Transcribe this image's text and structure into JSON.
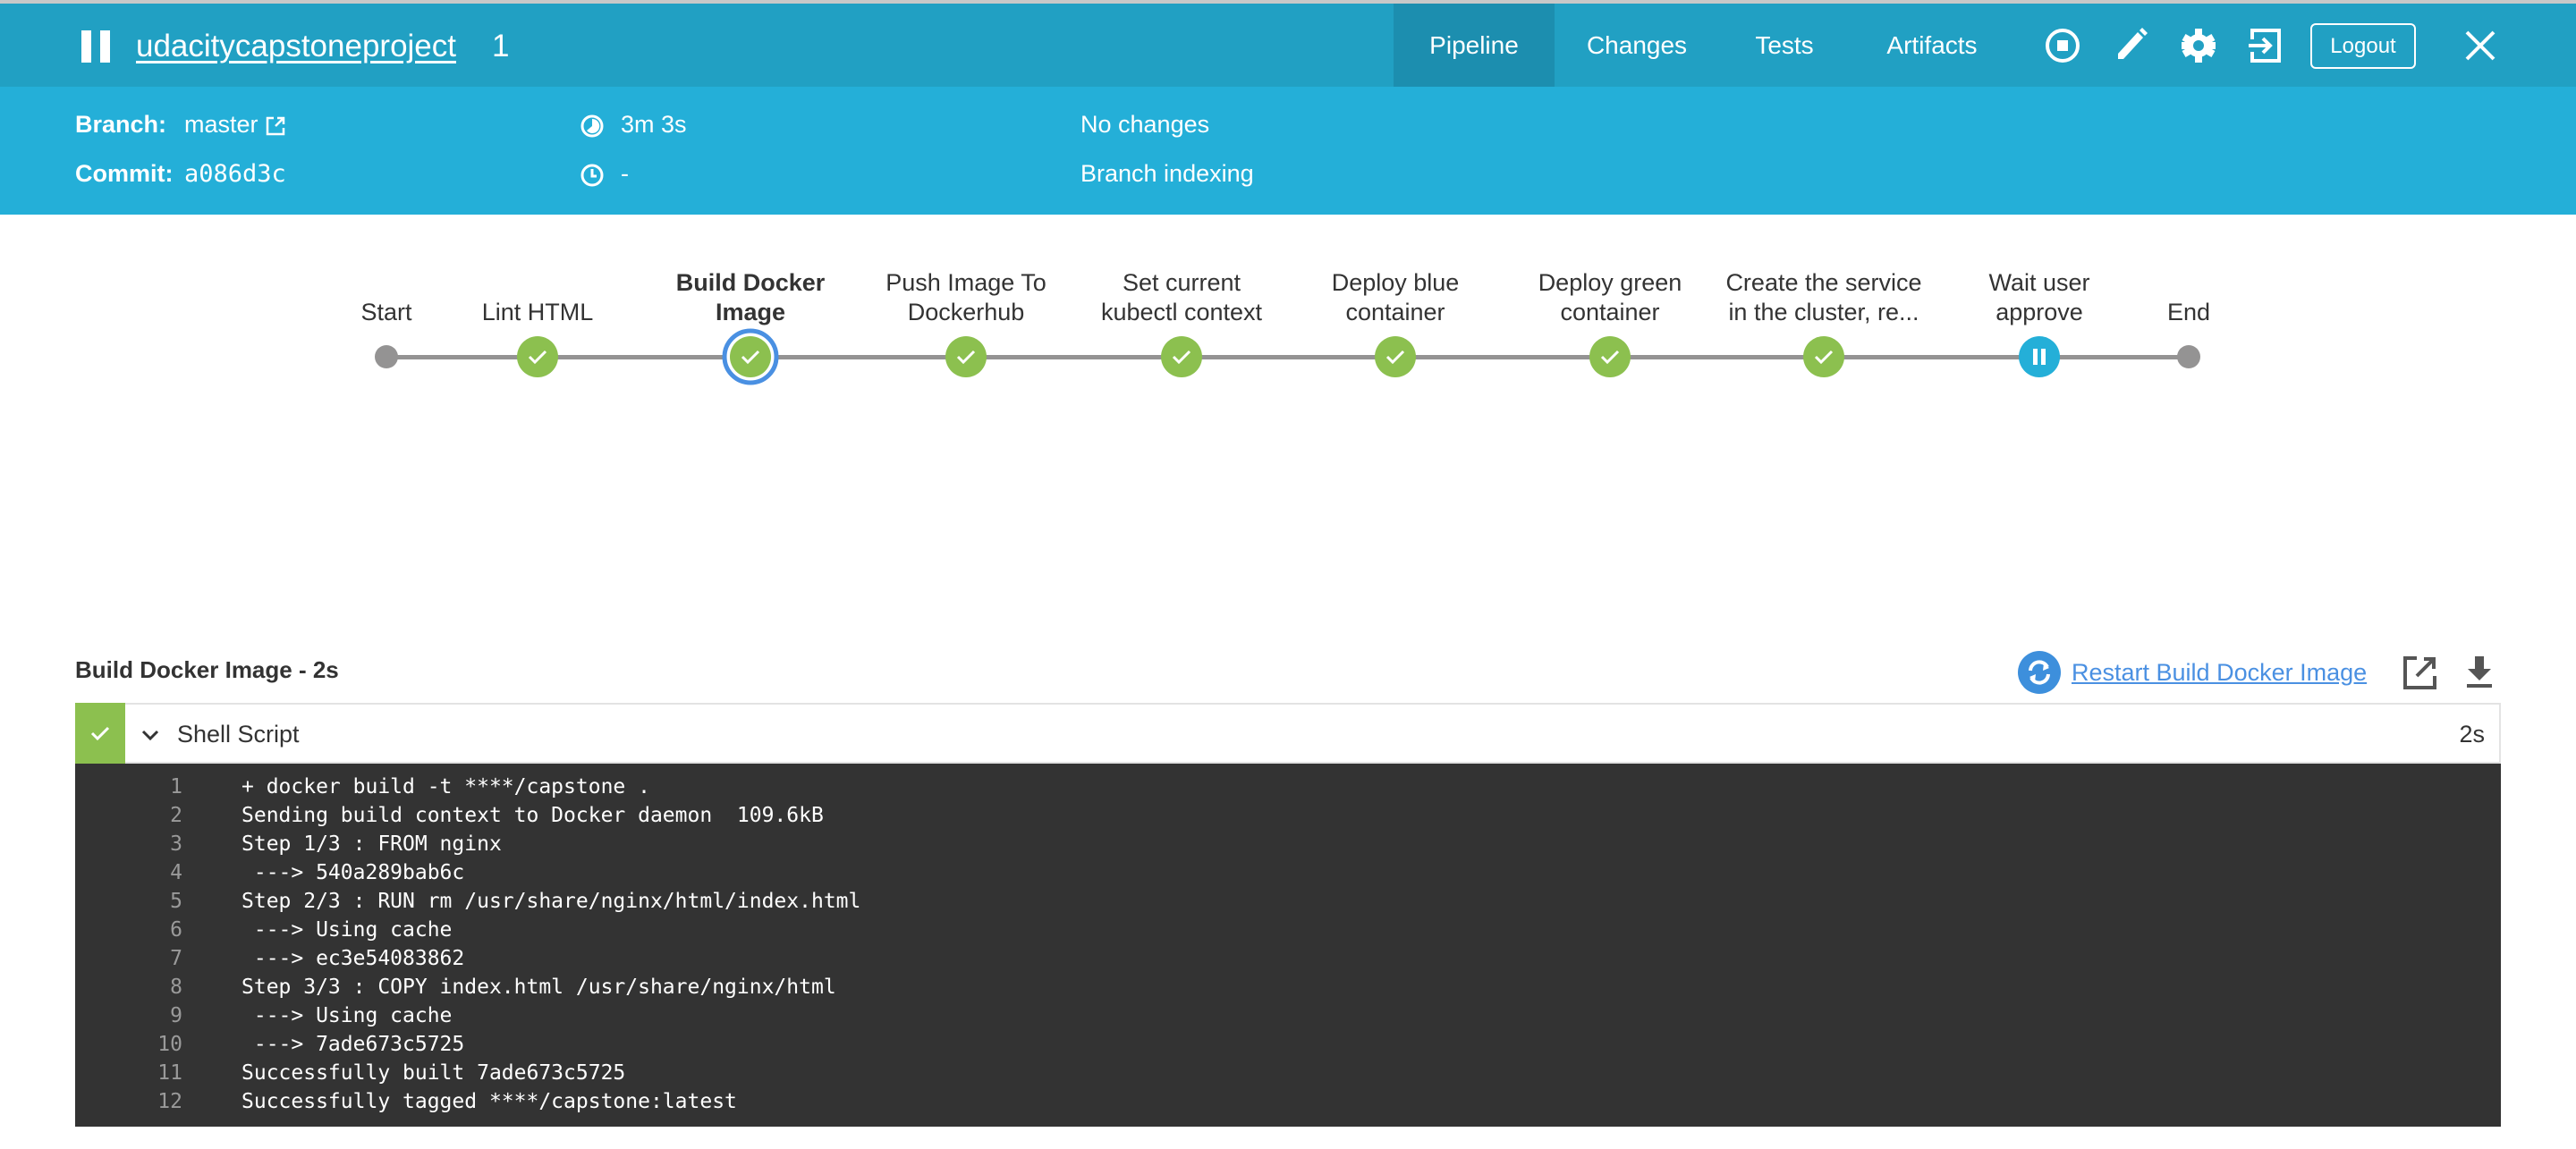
{
  "header": {
    "title": "udacitycapstoneproject",
    "run_number": "1",
    "tabs": [
      {
        "label": "Pipeline",
        "active": true
      },
      {
        "label": "Changes"
      },
      {
        "label": "Tests"
      },
      {
        "label": "Artifacts"
      }
    ],
    "logout_label": "Logout"
  },
  "info": {
    "branch_label": "Branch:",
    "branch_value": "master",
    "commit_label": "Commit:",
    "commit_value": "a086d3c",
    "duration": "3m 3s",
    "started": "-",
    "changes": "No changes",
    "cause": "Branch indexing"
  },
  "pipeline": {
    "stages": [
      {
        "label": "Start",
        "status": "start"
      },
      {
        "label": "Lint HTML",
        "status": "success"
      },
      {
        "label": "Build Docker\nImage",
        "status": "success",
        "selected": true
      },
      {
        "label": "Push Image To\nDockerhub",
        "status": "success"
      },
      {
        "label": "Set current\nkubectl context",
        "status": "success"
      },
      {
        "label": "Deploy blue\ncontainer",
        "status": "success"
      },
      {
        "label": "Deploy green\ncontainer",
        "status": "success"
      },
      {
        "label": "Create the service\nin the cluster, re...",
        "status": "success"
      },
      {
        "label": "Wait user\napprove",
        "status": "paused"
      },
      {
        "label": "End",
        "status": "end"
      }
    ],
    "colors": {
      "success": "#8cc04f",
      "paused": "#24afd8",
      "selected_ring": "#4a90e2",
      "line": "#949393"
    }
  },
  "detail": {
    "title": "Build Docker Image - 2s",
    "restart_label": "Restart Build Docker Image",
    "step": {
      "name": "Shell Script",
      "duration": "2s",
      "status": "success"
    },
    "log": [
      "+ docker build -t ****/capstone .",
      "Sending build context to Docker daemon  109.6kB",
      "Step 1/3 : FROM nginx",
      " ---> 540a289bab6c",
      "Step 2/3 : RUN rm /usr/share/nginx/html/index.html",
      " ---> Using cache",
      " ---> ec3e54083862",
      "Step 3/3 : COPY index.html /usr/share/nginx/html",
      " ---> Using cache",
      " ---> 7ade673c5725",
      "Successfully built 7ade673c5725",
      "Successfully tagged ****/capstone:latest"
    ]
  }
}
